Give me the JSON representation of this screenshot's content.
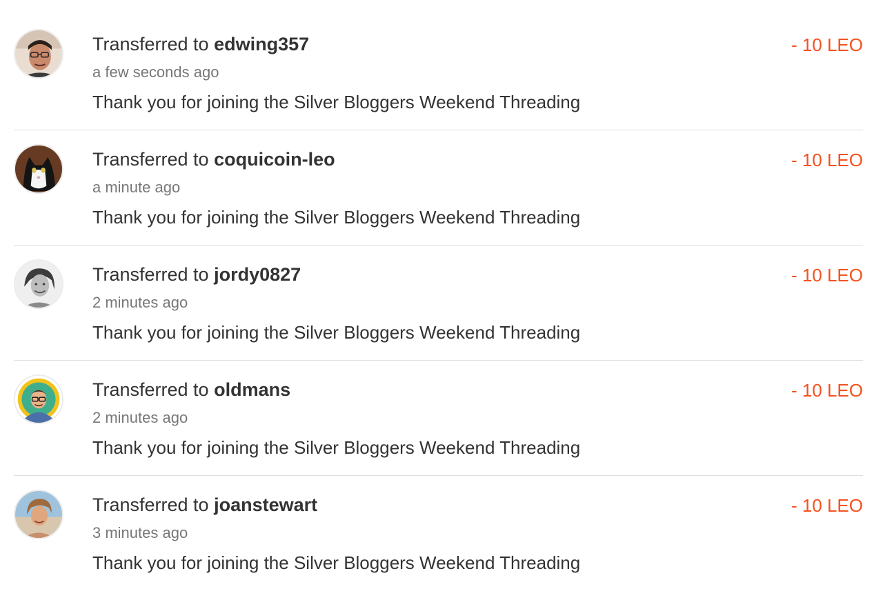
{
  "accent_color": "#f4511e",
  "transfers": [
    {
      "prefix": "Transferred to",
      "user": "edwing357",
      "time": "a few seconds ago",
      "memo": "Thank you for joining the Silver Bloggers Weekend Threading",
      "amount": "- 10 LEO",
      "avatar_icon": "person-with-glasses-avatar"
    },
    {
      "prefix": "Transferred to",
      "user": "coquicoin-leo",
      "time": "a minute ago",
      "memo": "Thank you for joining the Silver Bloggers Weekend Threading",
      "amount": "- 10 LEO",
      "avatar_icon": "black-white-cat-avatar"
    },
    {
      "prefix": "Transferred to",
      "user": "jordy0827",
      "time": "2 minutes ago",
      "memo": "Thank you for joining the Silver Bloggers Weekend Threading",
      "amount": "- 10 LEO",
      "avatar_icon": "grayscale-woman-avatar"
    },
    {
      "prefix": "Transferred to",
      "user": "oldmans",
      "time": "2 minutes ago",
      "memo": "Thank you for joining the Silver Bloggers Weekend Threading",
      "amount": "- 10 LEO",
      "avatar_icon": "cartoon-man-avatar"
    },
    {
      "prefix": "Transferred to",
      "user": "joanstewart",
      "time": "3 minutes ago",
      "memo": "Thank you for joining the Silver Bloggers Weekend Threading",
      "amount": "- 10 LEO",
      "avatar_icon": "woman-beach-avatar"
    }
  ]
}
